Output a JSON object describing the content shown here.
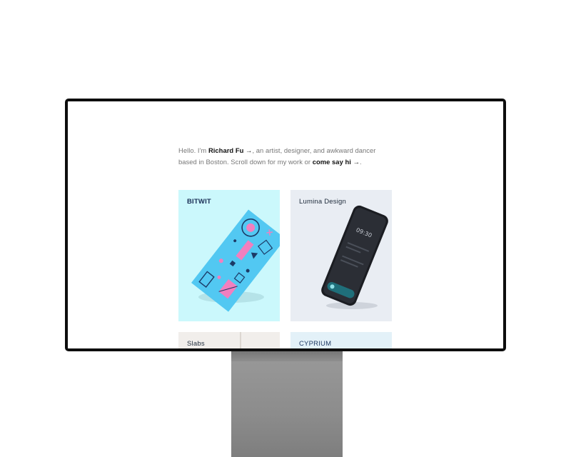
{
  "intro": {
    "greeting": "Hello. I'm",
    "name_link": "Richard Fu →",
    "middle": ", an artist, designer, and awkward dancer based in Boston. Scroll down for my work or",
    "contact_link": "come say hi →",
    "end": "."
  },
  "projects": [
    {
      "title": "BITWIT",
      "bg": "#cbf8fc"
    },
    {
      "title": "Lumina Design",
      "bg": "#e9edf3"
    },
    {
      "title": "Slabs",
      "bg": "#f1eeeb"
    },
    {
      "title": "CYPRIUM",
      "bg": "#e3f1f8"
    }
  ],
  "phone": {
    "time": "09:30"
  }
}
